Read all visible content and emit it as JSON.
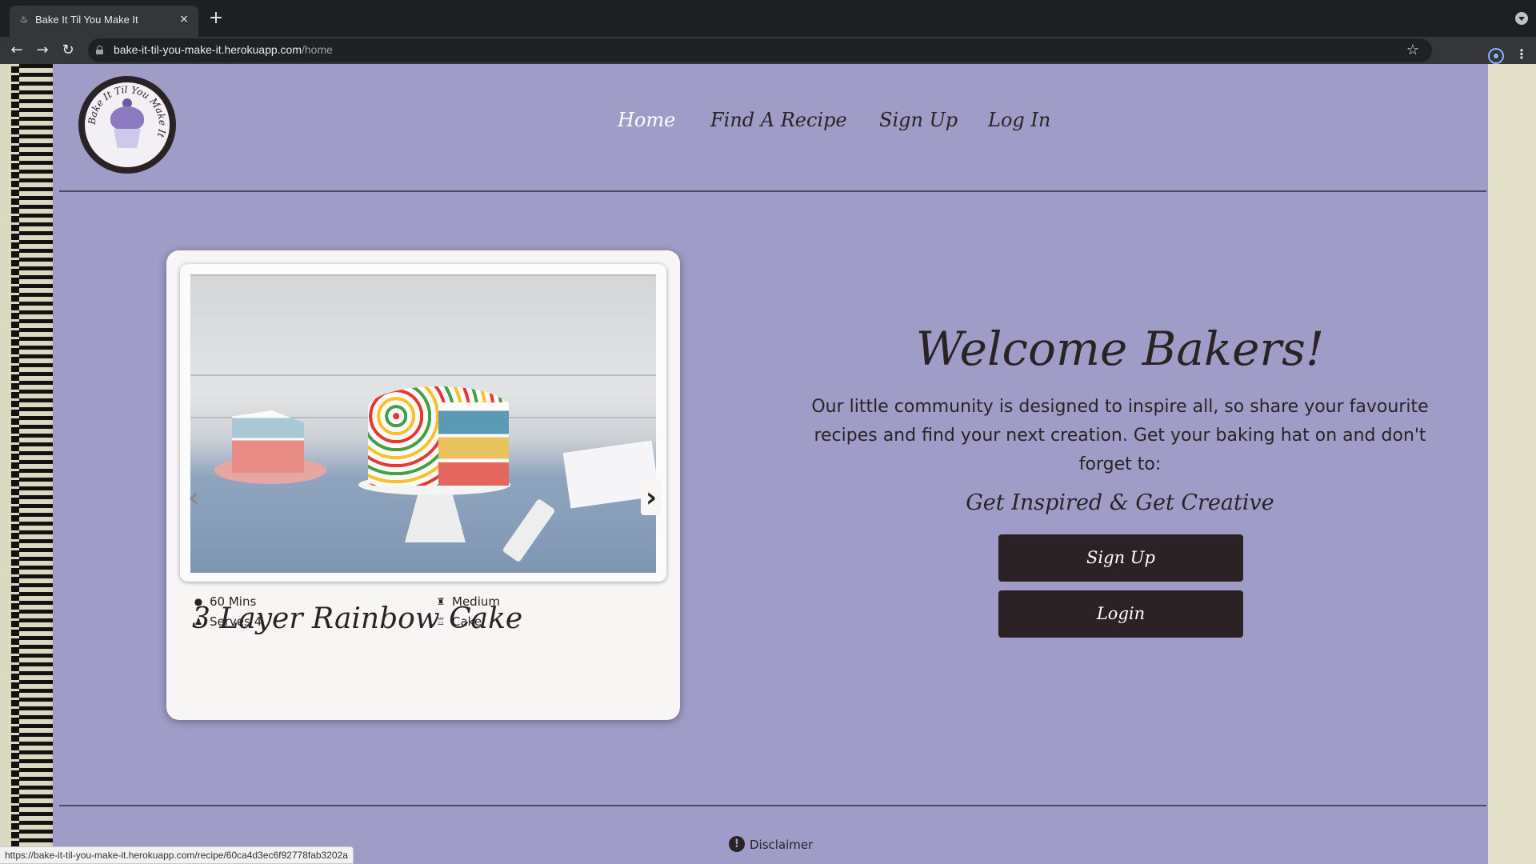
{
  "browser": {
    "tab_title": "Bake It Til You Make It",
    "tab_favicon": "cupcake-favicon",
    "tab_close": "×",
    "new_tab": "+",
    "url_host": "bake-it-til-you-make-it.herokuapp.com",
    "url_path": "/home",
    "star": "☆",
    "kebab": "⋮",
    "back": "←",
    "forward": "→",
    "reload": "↻"
  },
  "logo": {
    "text": "Bake It Til You Make It",
    "colors": {
      "ring": "#2b2225",
      "frosting": "#8c7ac0"
    }
  },
  "nav": {
    "items": [
      {
        "label": "Home",
        "active": true
      },
      {
        "label": "Find A Recipe",
        "active": false
      },
      {
        "label": "Sign Up",
        "active": false
      },
      {
        "label": "Log In",
        "active": false
      }
    ]
  },
  "carousel": {
    "prev": "‹",
    "next": "›",
    "recipe": {
      "title": "3 Layer Rainbow Cake",
      "time": "60 Mins",
      "serves": "Serves 4",
      "difficulty": "Medium",
      "category": "Cake"
    }
  },
  "welcome": {
    "title": "Welcome Bakers!",
    "text": "Our little community is designed to inspire all, so share your favourite recipes and find your next creation. Get your baking hat on and don't forget to:",
    "tagline": "Get Inspired & Get Creative",
    "signup_label": "Sign Up",
    "login_label": "Login"
  },
  "footer": {
    "disclaimer": "Disclaimer",
    "disclaimer_icon": "!"
  },
  "status_bar": {
    "url": "https://bake-it-til-you-make-it.herokuapp.com/recipe/60ca4d3ec6f92778fab3202a"
  },
  "colors": {
    "notebook": "#9f9cc7",
    "button": "#2b2225",
    "text": "#2a2325",
    "nav_active": "#ffffff"
  }
}
